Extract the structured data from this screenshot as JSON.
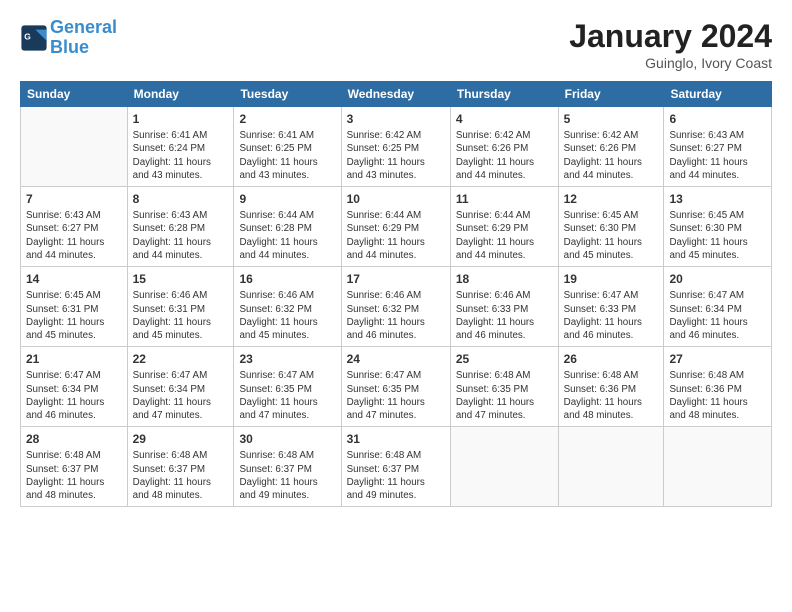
{
  "header": {
    "logo_line1": "General",
    "logo_line2": "Blue",
    "month_title": "January 2024",
    "location": "Guinglo, Ivory Coast"
  },
  "weekdays": [
    "Sunday",
    "Monday",
    "Tuesday",
    "Wednesday",
    "Thursday",
    "Friday",
    "Saturday"
  ],
  "weeks": [
    [
      {
        "day": "",
        "info": ""
      },
      {
        "day": "1",
        "info": "Sunrise: 6:41 AM\nSunset: 6:24 PM\nDaylight: 11 hours\nand 43 minutes."
      },
      {
        "day": "2",
        "info": "Sunrise: 6:41 AM\nSunset: 6:25 PM\nDaylight: 11 hours\nand 43 minutes."
      },
      {
        "day": "3",
        "info": "Sunrise: 6:42 AM\nSunset: 6:25 PM\nDaylight: 11 hours\nand 43 minutes."
      },
      {
        "day": "4",
        "info": "Sunrise: 6:42 AM\nSunset: 6:26 PM\nDaylight: 11 hours\nand 44 minutes."
      },
      {
        "day": "5",
        "info": "Sunrise: 6:42 AM\nSunset: 6:26 PM\nDaylight: 11 hours\nand 44 minutes."
      },
      {
        "day": "6",
        "info": "Sunrise: 6:43 AM\nSunset: 6:27 PM\nDaylight: 11 hours\nand 44 minutes."
      }
    ],
    [
      {
        "day": "7",
        "info": "Sunrise: 6:43 AM\nSunset: 6:27 PM\nDaylight: 11 hours\nand 44 minutes."
      },
      {
        "day": "8",
        "info": "Sunrise: 6:43 AM\nSunset: 6:28 PM\nDaylight: 11 hours\nand 44 minutes."
      },
      {
        "day": "9",
        "info": "Sunrise: 6:44 AM\nSunset: 6:28 PM\nDaylight: 11 hours\nand 44 minutes."
      },
      {
        "day": "10",
        "info": "Sunrise: 6:44 AM\nSunset: 6:29 PM\nDaylight: 11 hours\nand 44 minutes."
      },
      {
        "day": "11",
        "info": "Sunrise: 6:44 AM\nSunset: 6:29 PM\nDaylight: 11 hours\nand 44 minutes."
      },
      {
        "day": "12",
        "info": "Sunrise: 6:45 AM\nSunset: 6:30 PM\nDaylight: 11 hours\nand 45 minutes."
      },
      {
        "day": "13",
        "info": "Sunrise: 6:45 AM\nSunset: 6:30 PM\nDaylight: 11 hours\nand 45 minutes."
      }
    ],
    [
      {
        "day": "14",
        "info": "Sunrise: 6:45 AM\nSunset: 6:31 PM\nDaylight: 11 hours\nand 45 minutes."
      },
      {
        "day": "15",
        "info": "Sunrise: 6:46 AM\nSunset: 6:31 PM\nDaylight: 11 hours\nand 45 minutes."
      },
      {
        "day": "16",
        "info": "Sunrise: 6:46 AM\nSunset: 6:32 PM\nDaylight: 11 hours\nand 45 minutes."
      },
      {
        "day": "17",
        "info": "Sunrise: 6:46 AM\nSunset: 6:32 PM\nDaylight: 11 hours\nand 46 minutes."
      },
      {
        "day": "18",
        "info": "Sunrise: 6:46 AM\nSunset: 6:33 PM\nDaylight: 11 hours\nand 46 minutes."
      },
      {
        "day": "19",
        "info": "Sunrise: 6:47 AM\nSunset: 6:33 PM\nDaylight: 11 hours\nand 46 minutes."
      },
      {
        "day": "20",
        "info": "Sunrise: 6:47 AM\nSunset: 6:34 PM\nDaylight: 11 hours\nand 46 minutes."
      }
    ],
    [
      {
        "day": "21",
        "info": "Sunrise: 6:47 AM\nSunset: 6:34 PM\nDaylight: 11 hours\nand 46 minutes."
      },
      {
        "day": "22",
        "info": "Sunrise: 6:47 AM\nSunset: 6:34 PM\nDaylight: 11 hours\nand 47 minutes."
      },
      {
        "day": "23",
        "info": "Sunrise: 6:47 AM\nSunset: 6:35 PM\nDaylight: 11 hours\nand 47 minutes."
      },
      {
        "day": "24",
        "info": "Sunrise: 6:47 AM\nSunset: 6:35 PM\nDaylight: 11 hours\nand 47 minutes."
      },
      {
        "day": "25",
        "info": "Sunrise: 6:48 AM\nSunset: 6:35 PM\nDaylight: 11 hours\nand 47 minutes."
      },
      {
        "day": "26",
        "info": "Sunrise: 6:48 AM\nSunset: 6:36 PM\nDaylight: 11 hours\nand 48 minutes."
      },
      {
        "day": "27",
        "info": "Sunrise: 6:48 AM\nSunset: 6:36 PM\nDaylight: 11 hours\nand 48 minutes."
      }
    ],
    [
      {
        "day": "28",
        "info": "Sunrise: 6:48 AM\nSunset: 6:37 PM\nDaylight: 11 hours\nand 48 minutes."
      },
      {
        "day": "29",
        "info": "Sunrise: 6:48 AM\nSunset: 6:37 PM\nDaylight: 11 hours\nand 48 minutes."
      },
      {
        "day": "30",
        "info": "Sunrise: 6:48 AM\nSunset: 6:37 PM\nDaylight: 11 hours\nand 49 minutes."
      },
      {
        "day": "31",
        "info": "Sunrise: 6:48 AM\nSunset: 6:37 PM\nDaylight: 11 hours\nand 49 minutes."
      },
      {
        "day": "",
        "info": ""
      },
      {
        "day": "",
        "info": ""
      },
      {
        "day": "",
        "info": ""
      }
    ]
  ]
}
